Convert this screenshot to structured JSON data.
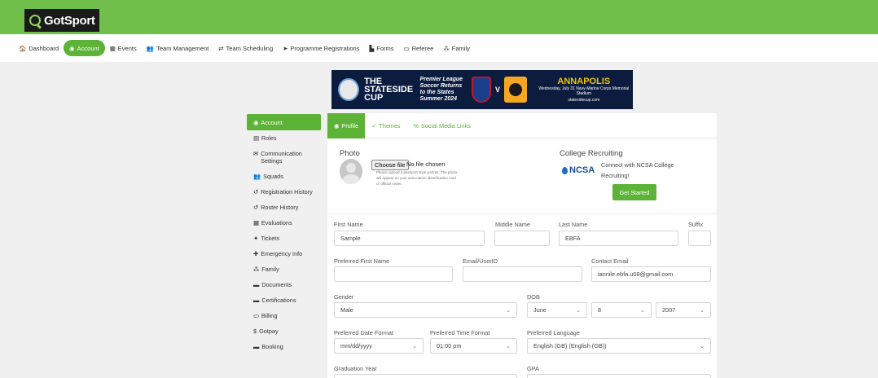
{
  "brand": {
    "logo_text": "GotSport"
  },
  "nav": [
    {
      "icon": "🏠",
      "label": "Dashboard",
      "name": "dashboard"
    },
    {
      "icon": "◉",
      "label": "Account",
      "name": "account",
      "active": true
    },
    {
      "icon": "▦",
      "label": "Events",
      "name": "events"
    },
    {
      "icon": "👥",
      "label": "Team Management",
      "name": "team-management"
    },
    {
      "icon": "⇄",
      "label": "Team Scheduling",
      "name": "team-scheduling"
    },
    {
      "icon": "➤",
      "label": "Programme Registrations",
      "name": "programme-registrations"
    },
    {
      "icon": "▙",
      "label": "Forms",
      "name": "forms"
    },
    {
      "icon": "▭",
      "label": "Referee",
      "name": "referee"
    },
    {
      "icon": "⁂",
      "label": "Family",
      "name": "family"
    }
  ],
  "banner": {
    "title": "THE STATESIDE CUP",
    "subtitle": "Premier League Soccer Returns to the States Summer 2024",
    "versus": "V",
    "city": "ANNAPOLIS",
    "date": "Wednesday, July 31 Navy-Marine Corps Memorial Stadium",
    "url": "statesidecup.com"
  },
  "sidebar": [
    {
      "icon": "◉",
      "label": "Account",
      "active": true
    },
    {
      "icon": "▤",
      "label": "Roles"
    },
    {
      "icon": "✉",
      "label": "Communication Settings"
    },
    {
      "icon": "👥",
      "label": "Squads"
    },
    {
      "icon": "↺",
      "label": "Registration History"
    },
    {
      "icon": "↺",
      "label": "Roster History"
    },
    {
      "icon": "▦",
      "label": "Evaluations"
    },
    {
      "icon": "✦",
      "label": "Tickets"
    },
    {
      "icon": "✚",
      "label": "Emergency Info"
    },
    {
      "icon": "⁂",
      "label": "Family"
    },
    {
      "icon": "▬",
      "label": "Documents"
    },
    {
      "icon": "▬",
      "label": "Certifications"
    },
    {
      "icon": "▭",
      "label": "Billing"
    },
    {
      "icon": "$",
      "label": "Gotpay"
    },
    {
      "icon": "▬",
      "label": "Booking"
    }
  ],
  "tabs": [
    {
      "icon": "◉",
      "label": "Profile",
      "active": true
    },
    {
      "icon": "✓",
      "label": "Themes"
    },
    {
      "icon": "%",
      "label": "Social Media Links"
    }
  ],
  "photo": {
    "heading": "Photo",
    "choose_label": "Choose file",
    "no_file": "No file chosen",
    "note": "Please upload a passport style portrait. The photo will appear on your association identification card or official roster."
  },
  "college": {
    "heading": "College Recruiting",
    "logo_text": "NCSA",
    "text": "Connect with NCSA College Recruiting!",
    "button": "Get Started"
  },
  "form": {
    "first_name": {
      "label": "First Name",
      "value": "Sample"
    },
    "middle_name": {
      "label": "Middle Name",
      "value": ""
    },
    "last_name": {
      "label": "Last Name",
      "value": "EBFA"
    },
    "suffix": {
      "label": "Suffix",
      "value": ""
    },
    "preferred_first": {
      "label": "Preferred First Name",
      "value": ""
    },
    "email_userid": {
      "label": "Email/UserID",
      "value": ""
    },
    "contact_email": {
      "label": "Contact Email",
      "value": "iannile.ebfa.u08@gmail.com"
    },
    "gender": {
      "label": "Gender",
      "value": "Male"
    },
    "dob": {
      "label": "DOB",
      "month": "June",
      "day": "8",
      "year": "2007"
    },
    "date_format": {
      "label": "Preferred Date Format",
      "value": "mm/dd/yyyy"
    },
    "time_format": {
      "label": "Preferred Time Format",
      "value": "01:00 pm"
    },
    "language": {
      "label": "Preferred Language",
      "value": "English (GB) (English (GB))"
    },
    "graduation_year": {
      "label": "Graduation Year",
      "value": ""
    },
    "gpa": {
      "label": "GPA",
      "value": ""
    }
  }
}
